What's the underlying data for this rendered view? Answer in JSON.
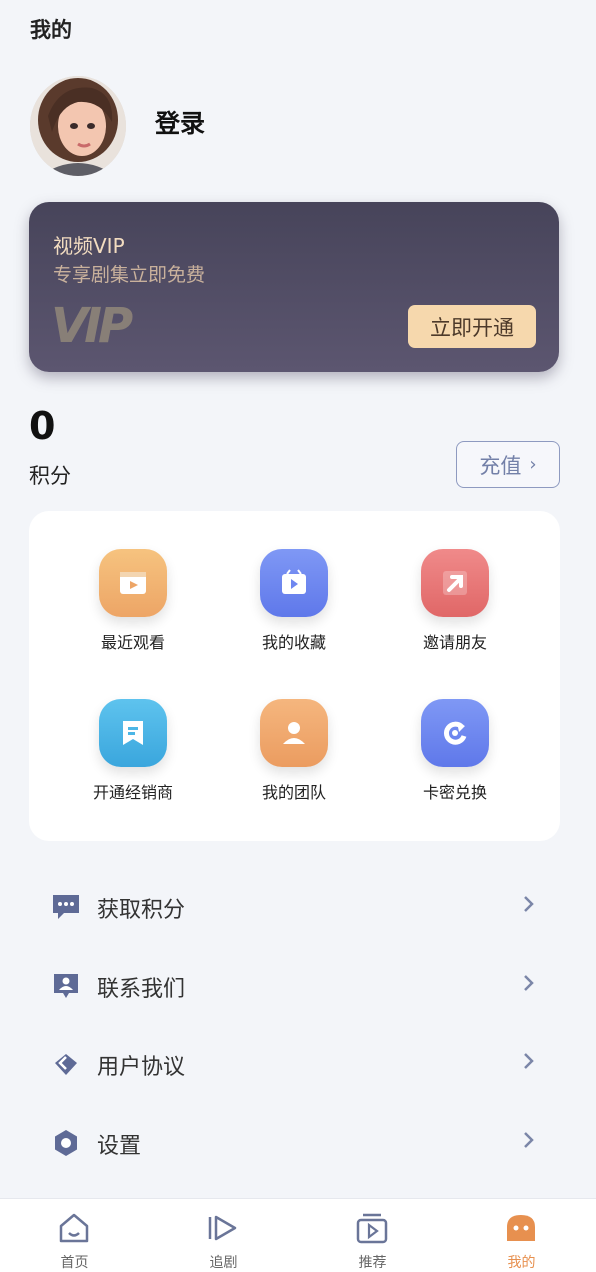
{
  "header": {
    "title": "我的"
  },
  "profile": {
    "login_label": "登录"
  },
  "vip": {
    "title": "视频VIP",
    "subtitle": "专享剧集立即免费",
    "logo_text": "VIP",
    "button_label": "立即开通",
    "colors": {
      "card": "#4f4a62",
      "accent": "#f6d8ad"
    }
  },
  "points": {
    "value": "0",
    "label": "积分",
    "recharge_label": "充值"
  },
  "quick_actions": [
    {
      "label": "最近观看",
      "icon": "film-icon",
      "color": "#f0b06e"
    },
    {
      "label": "我的收藏",
      "icon": "collection-icon",
      "color": "#6f87f0"
    },
    {
      "label": "邀请朋友",
      "icon": "share-arrow-icon",
      "color": "#ea7a7a"
    },
    {
      "label": "开通经销商",
      "icon": "bookmark-icon",
      "color": "#4cb6e6"
    },
    {
      "label": "我的团队",
      "icon": "person-icon",
      "color": "#f0a86e"
    },
    {
      "label": "卡密兑换",
      "icon": "refresh-icon",
      "color": "#6f87f0"
    }
  ],
  "menu": [
    {
      "label": "获取积分",
      "icon": "chat-icon"
    },
    {
      "label": "联系我们",
      "icon": "contact-icon"
    },
    {
      "label": "用户协议",
      "icon": "agreement-icon"
    },
    {
      "label": "设置",
      "icon": "settings-icon"
    }
  ],
  "tabbar": {
    "active_color": "#e7904f",
    "items": [
      {
        "label": "首页",
        "icon": "home-icon"
      },
      {
        "label": "追剧",
        "icon": "play-icon"
      },
      {
        "label": "推荐",
        "icon": "recommend-icon"
      },
      {
        "label": "我的",
        "icon": "mine-icon"
      }
    ]
  }
}
